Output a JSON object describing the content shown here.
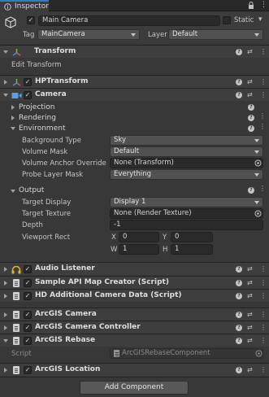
{
  "tab": {
    "label": "Inspector"
  },
  "gameobject": {
    "name": "Main Camera",
    "static_label": "Static",
    "tag_label": "Tag",
    "tag_value": "MainCamera",
    "layer_label": "Layer",
    "layer_value": "Default"
  },
  "transform": {
    "title": "Transform",
    "edit_label": "Edit Transform"
  },
  "components": {
    "hptransform": "HPTransform",
    "camera": "Camera",
    "audio_listener": "Audio Listener",
    "sample_api": "Sample API Map Creator (Script)",
    "hd_camera": "HD Additional Camera Data (Script)",
    "arcgis_camera": "ArcGIS Camera",
    "arcgis_camera_controller": "ArcGIS Camera Controller",
    "arcgis_rebase": "ArcGIS Rebase",
    "arcgis_location": "ArcGIS Location"
  },
  "camera": {
    "projection": "Projection",
    "rendering": "Rendering",
    "environment": "Environment",
    "background_type_label": "Background Type",
    "background_type_value": "Sky",
    "volume_mask_label": "Volume Mask",
    "volume_mask_value": "Default",
    "volume_anchor_label": "Volume Anchor Override",
    "volume_anchor_value": "None (Transform)",
    "probe_layer_label": "Probe Layer Mask",
    "probe_layer_value": "Everything",
    "output": "Output",
    "target_display_label": "Target Display",
    "target_display_value": "Display 1",
    "target_texture_label": "Target Texture",
    "target_texture_value": "None (Render Texture)",
    "depth_label": "Depth",
    "depth_value": "-1",
    "viewport_label": "Viewport Rect",
    "vp_x_label": "X",
    "vp_x_value": "0",
    "vp_y_label": "Y",
    "vp_y_value": "0",
    "vp_w_label": "W",
    "vp_w_value": "1",
    "vp_h_label": "H",
    "vp_h_value": "1"
  },
  "rebase": {
    "script_label": "Script",
    "script_value": "ArcGISRebaseComponent"
  },
  "add_component": "Add Component",
  "icons": {
    "help": "?",
    "preset": "⇄",
    "menu": "⋮",
    "lock": "🔒"
  },
  "colors": {
    "accent": "#3a79bb",
    "background": "#383838",
    "header": "#3e3e3e"
  }
}
